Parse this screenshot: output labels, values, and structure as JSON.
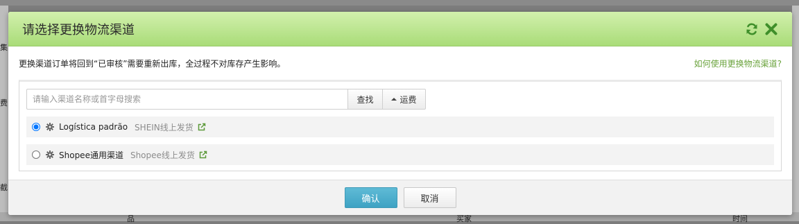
{
  "background": {
    "fragments": [
      "集",
      "费",
      "截",
      "品",
      "买家",
      "时间"
    ]
  },
  "modal": {
    "title": "请选择更换物流渠道",
    "refresh_icon": "refresh-icon",
    "close_icon": "close-icon",
    "info_text": "更换渠道订单将回到“已审核”需要重新出库，全过程不对库存产生影响。",
    "help_link": "如何使用更换物流渠道?",
    "search": {
      "placeholder": "请输入渠道名称或首字母搜索",
      "value": "",
      "find_label": "查找",
      "fee_label": "运费"
    },
    "channels": [
      {
        "name": "Logística padrão",
        "sub": "SHEIN线上发货",
        "selected": true
      },
      {
        "name": "Shopee通用渠道",
        "sub": "Shopee线上发货",
        "selected": false
      }
    ],
    "confirm_label": "确认",
    "cancel_label": "取消"
  },
  "colors": {
    "header_green": "#a9dc78",
    "link_green": "#6aa33c",
    "primary_blue": "#3ea2c3"
  }
}
